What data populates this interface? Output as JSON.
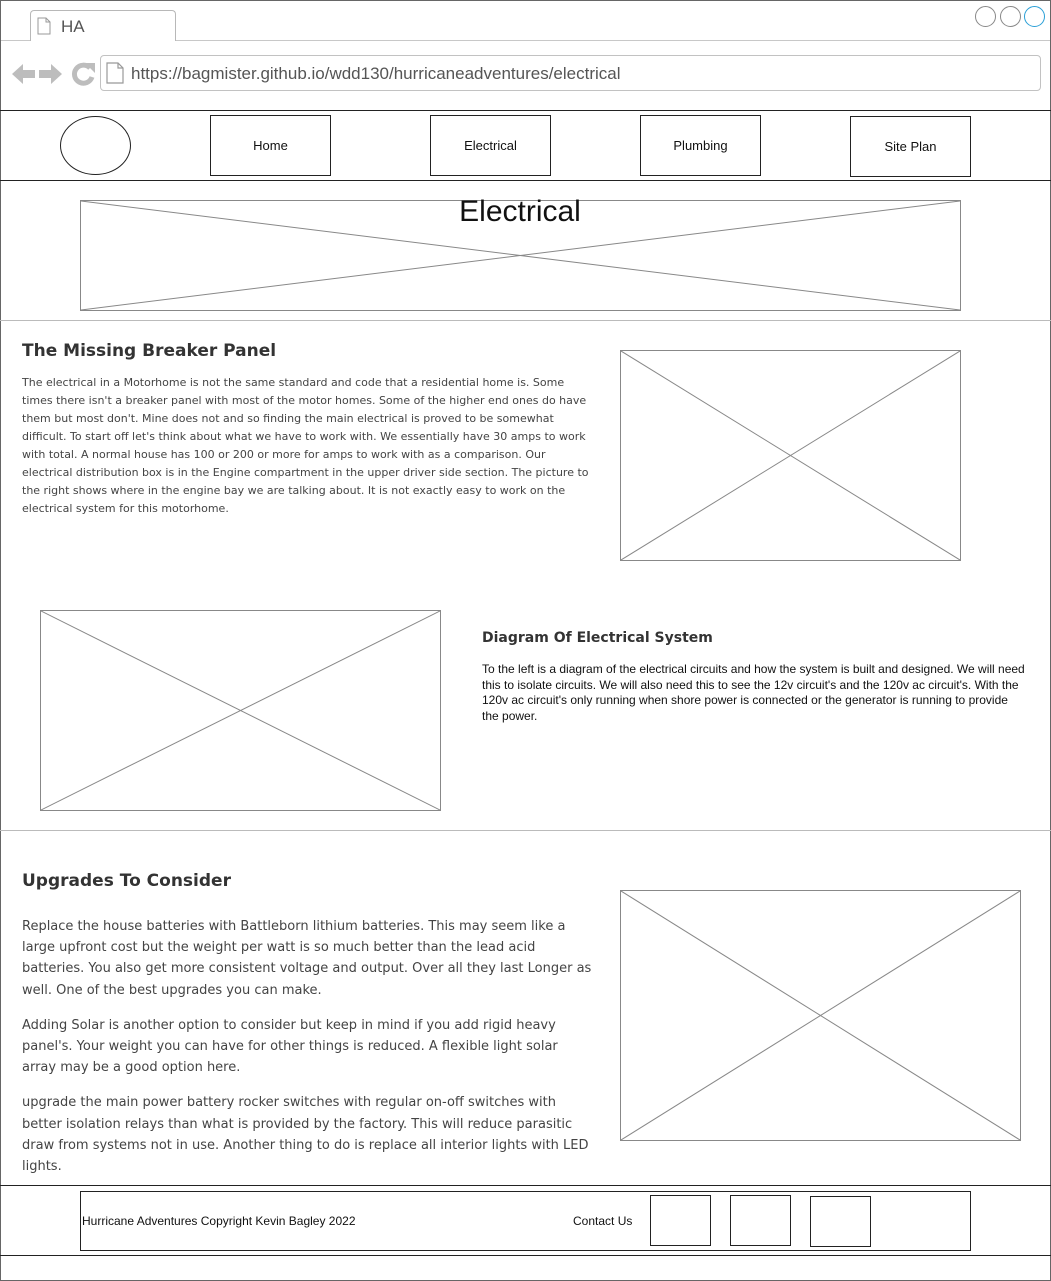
{
  "browser": {
    "tab_title": "HA",
    "url": "https://bagmister.github.io/wdd130/hurricaneadventures/electrical",
    "icons": [
      "back-arrow-icon",
      "forward-arrow-icon",
      "reload-icon",
      "document-icon"
    ]
  },
  "nav": {
    "items": [
      {
        "label": "Home"
      },
      {
        "label": "Electrical"
      },
      {
        "label": "Plumbing"
      },
      {
        "label": "Site Plan"
      }
    ]
  },
  "hero": {
    "title": "Electrical"
  },
  "section1": {
    "heading": "The Missing Breaker Panel",
    "body": "The electrical in a Motorhome is not the same standard and code that a residential home is. Some times there isn't a breaker panel with most of the motor homes. Some of the higher end ones do have them but most don't. Mine does not and so finding the main electrical is proved to be somewhat difficult. To start off let's think about what we have to work with. We essentially have 30 amps to work with total. A normal house has 100 or 200 or more for amps to work with as a comparison. Our electrical distribution box is in the Engine compartment in the upper driver side section. The picture to the right shows where in the engine bay we are talking about. It is not exactly easy to work on the electrical system for this motorhome."
  },
  "section2": {
    "heading": "Diagram Of Electrical System",
    "body": "To the left is a diagram of the electrical circuits and how the system is built and designed. We will need this to isolate circuits. We will also need this to see the 12v circuit's and the 120v ac circuit's. With the 120v ac circuit's only running when shore power is connected or the generator is running to provide the power."
  },
  "section3": {
    "heading": "Upgrades To Consider",
    "paragraphs": [
      "Replace the house batteries with Battleborn lithium batteries. This may seem like a large upfront cost but the weight per watt is so much better than the lead acid batteries. You also get more consistent voltage and output. Over all they last Longer as well. One of the best upgrades you can make.",
      "Adding Solar is another option to consider but keep in mind if you add rigid heavy panel's. Your weight you can have for other things is reduced. A flexible light solar array may be a good option here.",
      "upgrade the main power battery rocker switches with regular on-off switches with better isolation relays than what is provided by the factory. This will reduce parasitic draw from systems not in use. Another thing to do is replace all interior lights with LED lights."
    ]
  },
  "footer": {
    "copyright": "Hurricane Adventures Copyright Kevin Bagley 2022",
    "contact_label": "Contact Us"
  },
  "colors": {
    "window_active": "#2a9fd6",
    "border": "#222222",
    "placeholder_line": "#888888"
  }
}
